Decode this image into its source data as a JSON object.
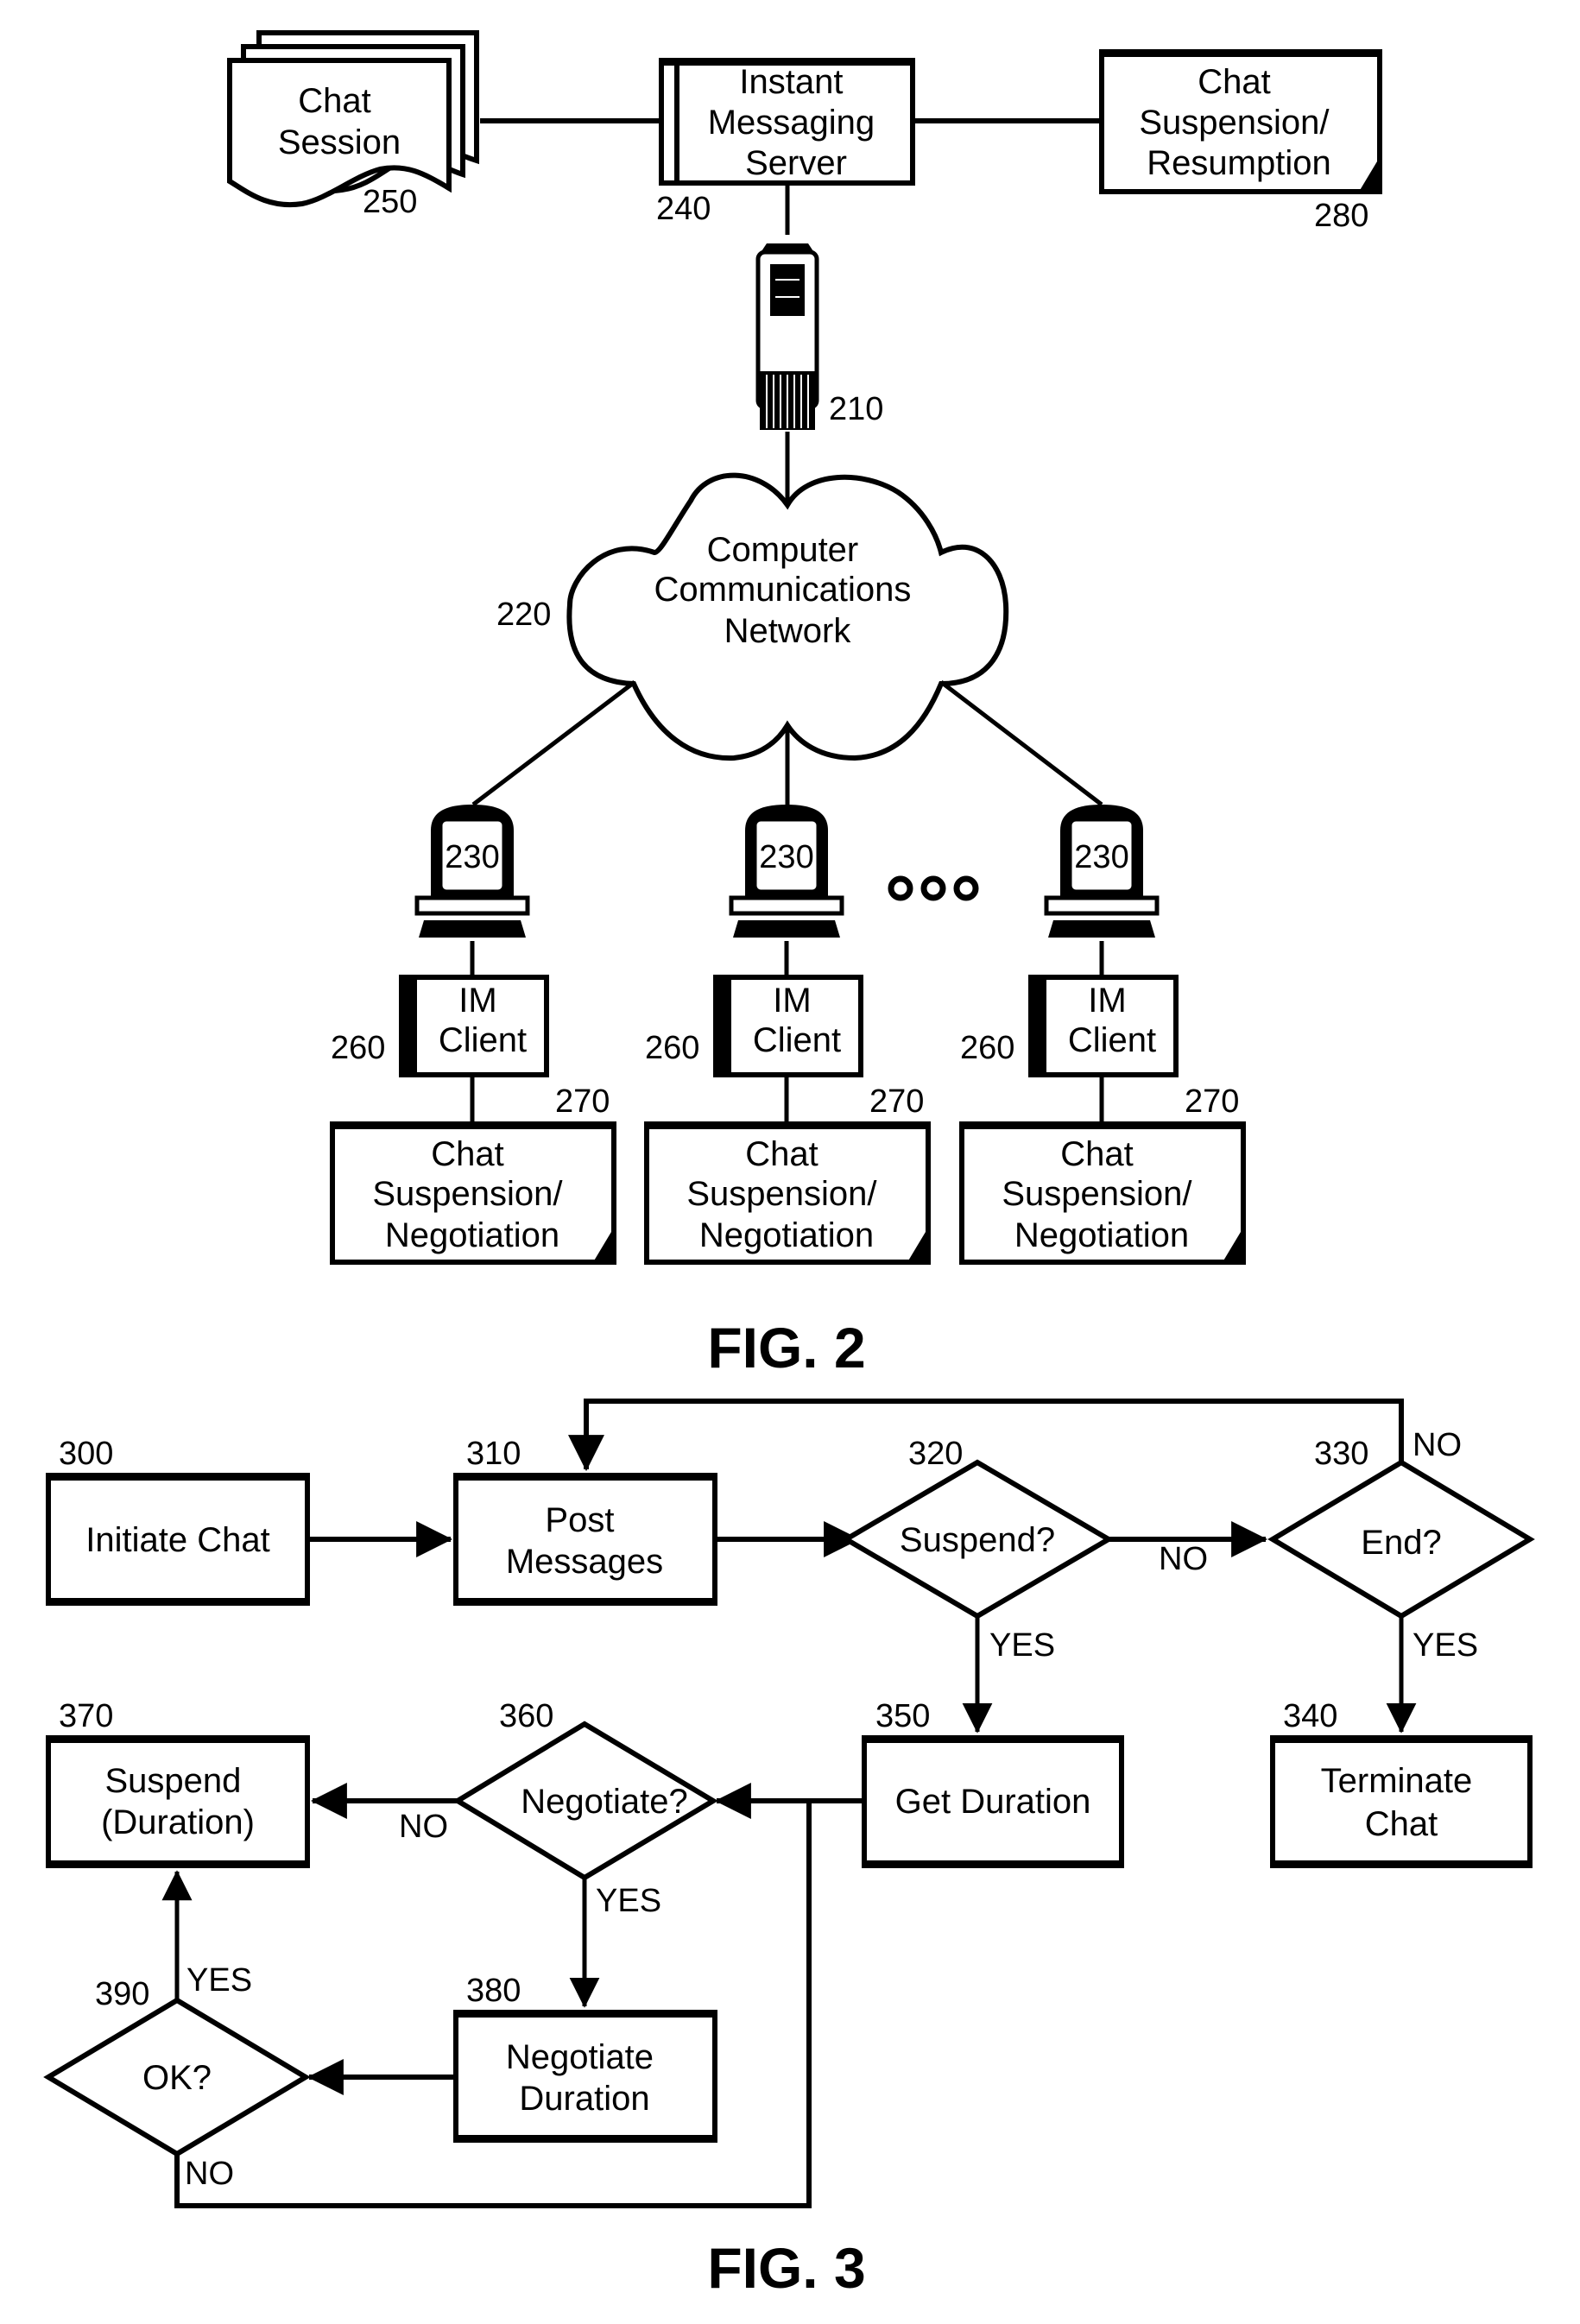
{
  "fig2": {
    "title": "FIG. 2",
    "chat_session": {
      "lines": [
        "Chat",
        "Session"
      ],
      "ref": "250"
    },
    "im_server": {
      "lines": [
        "Instant",
        "Messaging",
        "Server"
      ],
      "ref": "240"
    },
    "server_suspension": {
      "lines": [
        "Chat",
        "Suspension/",
        "Resumption"
      ],
      "ref": "280"
    },
    "host_server": {
      "ref": "210"
    },
    "network": {
      "lines": [
        "Computer",
        "Communications",
        "Network"
      ],
      "ref": "220"
    },
    "clients": [
      {
        "computer_ref": "230",
        "im_client": [
          "IM",
          "Client"
        ],
        "im_client_ref": "260",
        "module": [
          "Chat",
          "Suspension/",
          "Negotiation"
        ],
        "module_ref": "270"
      },
      {
        "computer_ref": "230",
        "im_client": [
          "IM",
          "Client"
        ],
        "im_client_ref": "260",
        "module": [
          "Chat",
          "Suspension/",
          "Negotiation"
        ],
        "module_ref": "270"
      },
      {
        "computer_ref": "230",
        "im_client": [
          "IM",
          "Client"
        ],
        "im_client_ref": "260",
        "module": [
          "Chat",
          "Suspension/",
          "Negotiation"
        ],
        "module_ref": "270"
      }
    ]
  },
  "fig3": {
    "title": "FIG. 3",
    "steps": {
      "s300": {
        "ref": "300",
        "lines": [
          "Initiate Chat"
        ]
      },
      "s310": {
        "ref": "310",
        "lines": [
          "Post",
          "Messages"
        ]
      },
      "s320": {
        "ref": "320",
        "lines": [
          "Suspend?"
        ]
      },
      "s330": {
        "ref": "330",
        "lines": [
          "End?"
        ]
      },
      "s340": {
        "ref": "340",
        "lines": [
          "Terminate",
          "Chat"
        ]
      },
      "s350": {
        "ref": "350",
        "lines": [
          "Get Duration"
        ]
      },
      "s360": {
        "ref": "360",
        "lines": [
          "Negotiate?"
        ]
      },
      "s370": {
        "ref": "370",
        "lines": [
          "Suspend",
          "(Duration)"
        ]
      },
      "s380": {
        "ref": "380",
        "lines": [
          "Negotiate",
          "Duration"
        ]
      },
      "s390": {
        "ref": "390",
        "lines": [
          "OK?"
        ]
      }
    },
    "edge_labels": {
      "suspend_no": "NO",
      "suspend_yes": "YES",
      "end_no": "NO",
      "end_yes": "YES",
      "negotiate_no": "NO",
      "negotiate_yes": "YES",
      "ok_yes": "YES",
      "ok_no": "NO"
    }
  }
}
